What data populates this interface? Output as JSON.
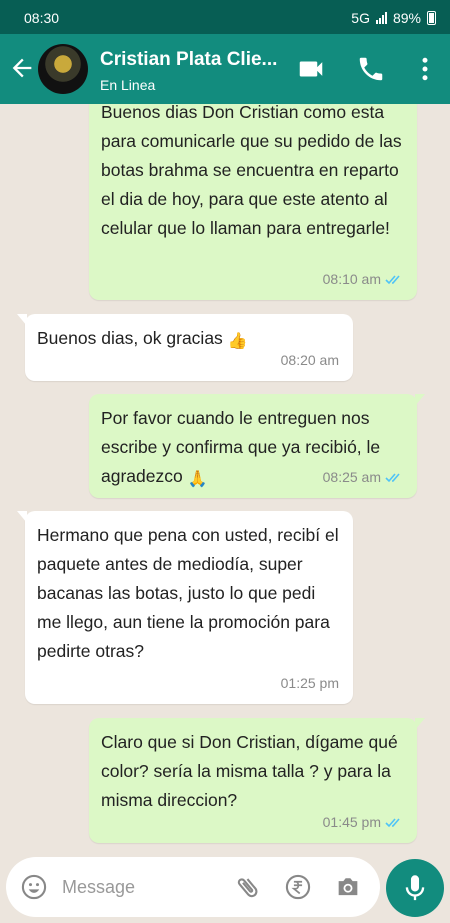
{
  "status_bar": {
    "time": "08:30",
    "network": "5G",
    "battery": "89%"
  },
  "header": {
    "contact_name": "Cristian Plata Clie...",
    "status": "En Linea"
  },
  "messages": [
    {
      "type": "outgoing",
      "text": "Buenos dias Don Cristian como esta para comunicarle que su pedido de las botas brahma se encuentra en reparto el dia de hoy, para que este atento al celular que lo llaman para entregarle!",
      "time": "08:10 am"
    },
    {
      "type": "incoming",
      "text": "Buenos dias, ok gracias",
      "emoji": "👍",
      "time": "08:20 am"
    },
    {
      "type": "outgoing",
      "text": "Por favor cuando le entreguen nos escribe y confirma que ya recibió, le agradezco",
      "emoji": "🙏",
      "time": "08:25 am"
    },
    {
      "type": "incoming",
      "text": "Hermano que pena con usted, recibí el paquete antes de mediodía, super bacanas las botas, justo lo que pedi me llego, aun tiene la promoción para pedirte otras?",
      "time": "01:25 pm"
    },
    {
      "type": "outgoing",
      "text": "Claro que si Don Cristian, dígame qué color? sería la misma talla ? y para la misma direccion?",
      "time": "01:45 pm"
    }
  ],
  "composer": {
    "placeholder": "Message"
  },
  "colors": {
    "header": "#128c7e",
    "status_bar": "#075e54",
    "outgoing_bubble": "#dcf8c6",
    "incoming_bubble": "#ffffff",
    "chat_bg": "#ece5dd",
    "read_tick": "#4fc3f7"
  },
  "icons": [
    "back-arrow-icon",
    "video-call-icon",
    "phone-icon",
    "more-options-icon",
    "emoji-icon",
    "attach-icon",
    "rupee-icon",
    "camera-icon",
    "mic-icon",
    "double-tick-icon"
  ]
}
